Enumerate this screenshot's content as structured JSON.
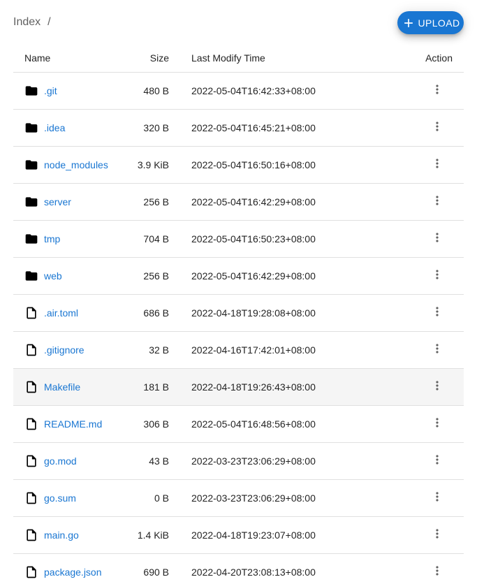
{
  "breadcrumb": {
    "root": "Index",
    "separator": "/"
  },
  "toolbar": {
    "upload_label": "Upload",
    "upload_icon": "plus-icon"
  },
  "table": {
    "headers": {
      "name": "Name",
      "size": "Size",
      "time": "Last Modify Time",
      "action": "Action"
    },
    "rows": [
      {
        "name": ".git",
        "size": "480 B",
        "time": "2022-05-04T16:42:33+08:00",
        "type": "folder"
      },
      {
        "name": ".idea",
        "size": "320 B",
        "time": "2022-05-04T16:45:21+08:00",
        "type": "folder"
      },
      {
        "name": "node_modules",
        "size": "3.9 KiB",
        "time": "2022-05-04T16:50:16+08:00",
        "type": "folder"
      },
      {
        "name": "server",
        "size": "256 B",
        "time": "2022-05-04T16:42:29+08:00",
        "type": "folder"
      },
      {
        "name": "tmp",
        "size": "704 B",
        "time": "2022-05-04T16:50:23+08:00",
        "type": "folder"
      },
      {
        "name": "web",
        "size": "256 B",
        "time": "2022-05-04T16:42:29+08:00",
        "type": "folder"
      },
      {
        "name": ".air.toml",
        "size": "686 B",
        "time": "2022-04-18T19:28:08+08:00",
        "type": "file"
      },
      {
        "name": ".gitignore",
        "size": "32 B",
        "time": "2022-04-16T17:42:01+08:00",
        "type": "file"
      },
      {
        "name": "Makefile",
        "size": "181 B",
        "time": "2022-04-18T19:26:43+08:00",
        "type": "file",
        "hover": true
      },
      {
        "name": "README.md",
        "size": "306 B",
        "time": "2022-05-04T16:48:56+08:00",
        "type": "file"
      },
      {
        "name": "go.mod",
        "size": "43 B",
        "time": "2022-03-23T23:06:29+08:00",
        "type": "file"
      },
      {
        "name": "go.sum",
        "size": "0 B",
        "time": "2022-03-23T23:06:29+08:00",
        "type": "file"
      },
      {
        "name": "main.go",
        "size": "1.4 KiB",
        "time": "2022-04-18T19:23:07+08:00",
        "type": "file"
      },
      {
        "name": "package.json",
        "size": "690 B",
        "time": "2022-04-20T23:08:13+08:00",
        "type": "file"
      }
    ]
  },
  "colors": {
    "accent": "#1976d2",
    "hover_row": "#f5f5f5",
    "divider": "#e0e0e0"
  }
}
